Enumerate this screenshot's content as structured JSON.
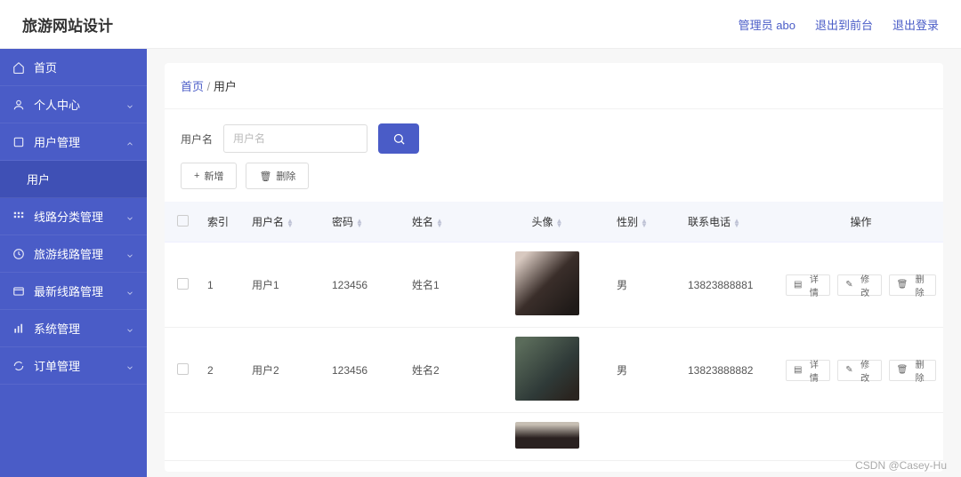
{
  "header": {
    "title": "旅游网站设计",
    "links": {
      "admin": "管理员 abo",
      "front": "退出到前台",
      "logout": "退出登录"
    }
  },
  "sidebar": {
    "items": [
      {
        "label": "首页",
        "icon": "home-icon",
        "chev": "none"
      },
      {
        "label": "个人中心",
        "icon": "user-icon",
        "chev": "down"
      },
      {
        "label": "用户管理",
        "icon": "users-icon",
        "chev": "up"
      },
      {
        "label": "用户",
        "icon": "none",
        "chev": "none",
        "sub": true
      },
      {
        "label": "线路分类管理",
        "icon": "grid-icon",
        "chev": "down"
      },
      {
        "label": "旅游线路管理",
        "icon": "clock-icon",
        "chev": "down"
      },
      {
        "label": "最新线路管理",
        "icon": "window-icon",
        "chev": "down"
      },
      {
        "label": "系统管理",
        "icon": "bars-icon",
        "chev": "down"
      },
      {
        "label": "订单管理",
        "icon": "refresh-icon",
        "chev": "down"
      }
    ]
  },
  "breadcrumb": {
    "home": "首页",
    "sep": "/",
    "current": "用户"
  },
  "search": {
    "label": "用户名",
    "placeholder": "用户名"
  },
  "actions": {
    "add": "新增",
    "delete": "删除"
  },
  "table": {
    "headers": {
      "index": "索引",
      "username": "用户名",
      "password": "密码",
      "name": "姓名",
      "avatar": "头像",
      "gender": "性别",
      "phone": "联系电话",
      "ops": "操作"
    },
    "opLabels": {
      "detail": "详情",
      "edit": "修改",
      "delete": "删除"
    },
    "rows": [
      {
        "index": "1",
        "username": "用户1",
        "password": "123456",
        "name": "姓名1",
        "gender": "男",
        "phone": "13823888881"
      },
      {
        "index": "2",
        "username": "用户2",
        "password": "123456",
        "name": "姓名2",
        "gender": "男",
        "phone": "13823888882"
      }
    ]
  },
  "watermark": "CSDN @Casey-Hu"
}
